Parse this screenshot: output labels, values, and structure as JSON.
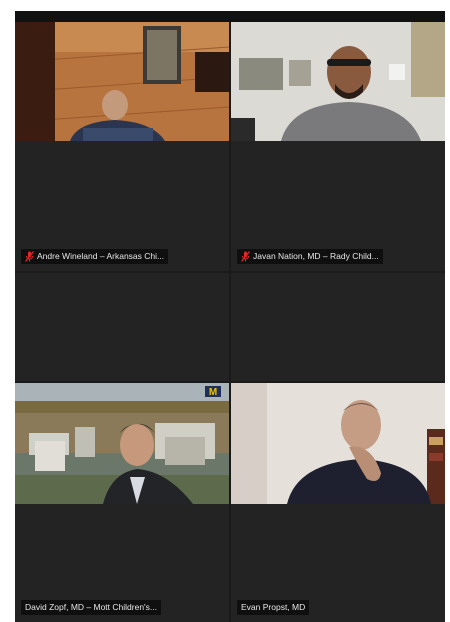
{
  "participants": [
    {
      "name": "Andre Wineland – Arkansas Chi...",
      "muted": true,
      "video": "wood-floor-room"
    },
    {
      "name": "Javan Nation, MD – Rady Child...",
      "muted": true,
      "video": "office-with-art"
    },
    {
      "name": "",
      "muted": false,
      "video": "none"
    },
    {
      "name": "",
      "muted": false,
      "video": "none"
    },
    {
      "name": "David Zopf, MD – Mott Children's...",
      "muted": false,
      "video": "campus-background"
    },
    {
      "name": "Evan Propst, MD",
      "muted": false,
      "video": "white-room"
    }
  ],
  "colors": {
    "tile_background": "#232323",
    "gallery_background": "#1a1a1a",
    "muted_icon": "#e02828",
    "label_text": "#e8e8e8"
  },
  "icons": {
    "muted": "mic-off-icon"
  }
}
